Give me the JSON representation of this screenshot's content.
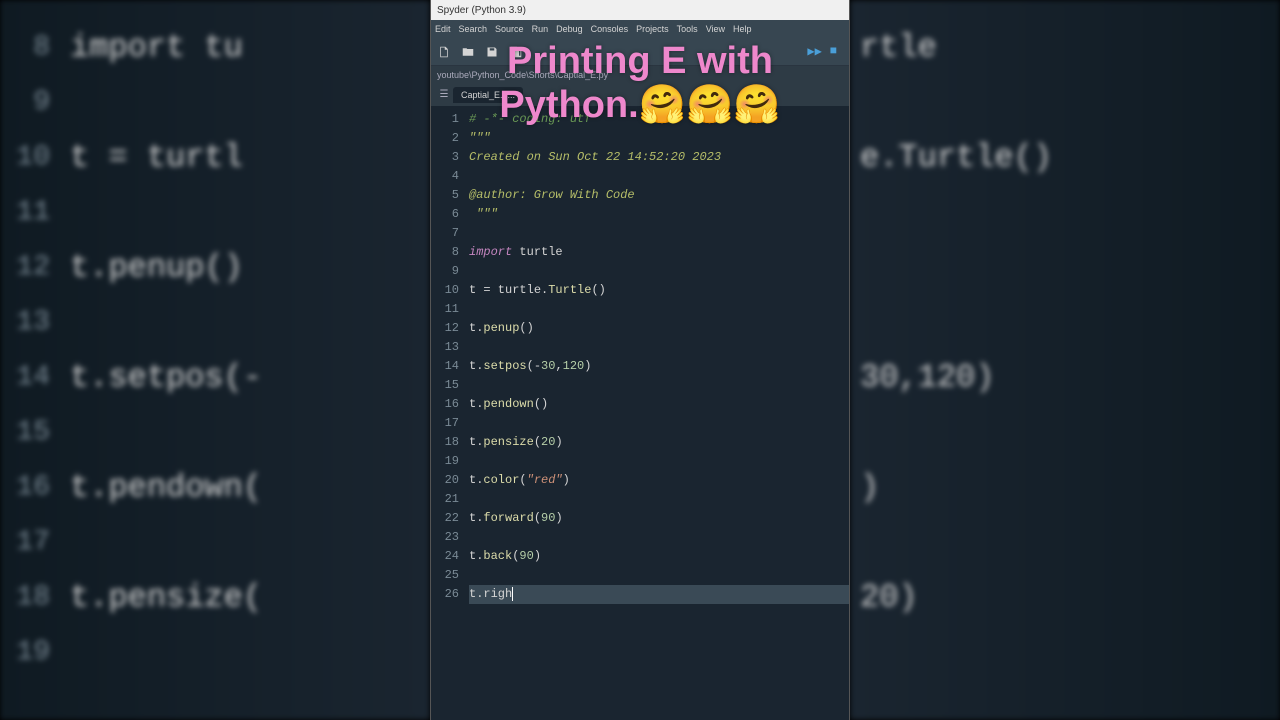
{
  "window": {
    "title": "Spyder (Python 3.9)"
  },
  "menu": [
    "Edit",
    "Search",
    "Source",
    "Run",
    "Debug",
    "Consoles",
    "Projects",
    "Tools",
    "View",
    "Help"
  ],
  "path": "youtube\\Python_Code\\Shorts\\Captial_E.py",
  "tab": {
    "name": "Captial_E.p..."
  },
  "overlay": {
    "line1": "Printing E with",
    "line2": "Python.🤗🤗🤗"
  },
  "code": {
    "lines": [
      {
        "n": 1,
        "t": [
          {
            "c": "c-comment",
            "v": "# -*- coding: utf"
          }
        ]
      },
      {
        "n": 2,
        "t": [
          {
            "c": "c-docstring",
            "v": "\"\"\""
          }
        ]
      },
      {
        "n": 3,
        "t": [
          {
            "c": "c-docstring",
            "v": "Created on Sun Oct 22 14:52:20 2023"
          }
        ]
      },
      {
        "n": 4,
        "t": []
      },
      {
        "n": 5,
        "t": [
          {
            "c": "c-docstring",
            "v": "@author: Grow With Code"
          }
        ]
      },
      {
        "n": 6,
        "t": [
          {
            "c": "c-docstring",
            "v": " \"\"\""
          }
        ]
      },
      {
        "n": 7,
        "t": []
      },
      {
        "n": 8,
        "t": [
          {
            "c": "c-keyword",
            "v": "import"
          },
          {
            "c": "c-ident",
            "v": " turtle"
          }
        ]
      },
      {
        "n": 9,
        "t": []
      },
      {
        "n": 10,
        "t": [
          {
            "c": "c-ident",
            "v": "t "
          },
          {
            "c": "c-op",
            "v": "="
          },
          {
            "c": "c-ident",
            "v": " turtle"
          },
          {
            "c": "c-op",
            "v": "."
          },
          {
            "c": "c-func",
            "v": "Turtle"
          },
          {
            "c": "c-op",
            "v": "()"
          }
        ]
      },
      {
        "n": 11,
        "t": []
      },
      {
        "n": 12,
        "t": [
          {
            "c": "c-ident",
            "v": "t"
          },
          {
            "c": "c-op",
            "v": "."
          },
          {
            "c": "c-func",
            "v": "penup"
          },
          {
            "c": "c-op",
            "v": "()"
          }
        ]
      },
      {
        "n": 13,
        "t": []
      },
      {
        "n": 14,
        "t": [
          {
            "c": "c-ident",
            "v": "t"
          },
          {
            "c": "c-op",
            "v": "."
          },
          {
            "c": "c-func",
            "v": "setpos"
          },
          {
            "c": "c-op",
            "v": "("
          },
          {
            "c": "c-op",
            "v": "-"
          },
          {
            "c": "c-number",
            "v": "30"
          },
          {
            "c": "c-op",
            "v": ","
          },
          {
            "c": "c-number",
            "v": "120"
          },
          {
            "c": "c-op",
            "v": ")"
          }
        ]
      },
      {
        "n": 15,
        "t": []
      },
      {
        "n": 16,
        "t": [
          {
            "c": "c-ident",
            "v": "t"
          },
          {
            "c": "c-op",
            "v": "."
          },
          {
            "c": "c-func",
            "v": "pendown"
          },
          {
            "c": "c-op",
            "v": "()"
          }
        ]
      },
      {
        "n": 17,
        "t": []
      },
      {
        "n": 18,
        "t": [
          {
            "c": "c-ident",
            "v": "t"
          },
          {
            "c": "c-op",
            "v": "."
          },
          {
            "c": "c-func",
            "v": "pensize"
          },
          {
            "c": "c-op",
            "v": "("
          },
          {
            "c": "c-number",
            "v": "20"
          },
          {
            "c": "c-op",
            "v": ")"
          }
        ]
      },
      {
        "n": 19,
        "t": []
      },
      {
        "n": 20,
        "t": [
          {
            "c": "c-ident",
            "v": "t"
          },
          {
            "c": "c-op",
            "v": "."
          },
          {
            "c": "c-func",
            "v": "color"
          },
          {
            "c": "c-op",
            "v": "("
          },
          {
            "c": "c-string",
            "v": "\"red\""
          },
          {
            "c": "c-op",
            "v": ")"
          }
        ]
      },
      {
        "n": 21,
        "t": []
      },
      {
        "n": 22,
        "t": [
          {
            "c": "c-ident",
            "v": "t"
          },
          {
            "c": "c-op",
            "v": "."
          },
          {
            "c": "c-func",
            "v": "forward"
          },
          {
            "c": "c-op",
            "v": "("
          },
          {
            "c": "c-number",
            "v": "90"
          },
          {
            "c": "c-op",
            "v": ")"
          }
        ]
      },
      {
        "n": 23,
        "t": []
      },
      {
        "n": 24,
        "t": [
          {
            "c": "c-ident",
            "v": "t"
          },
          {
            "c": "c-op",
            "v": "."
          },
          {
            "c": "c-func",
            "v": "back"
          },
          {
            "c": "c-op",
            "v": "("
          },
          {
            "c": "c-number",
            "v": "90"
          },
          {
            "c": "c-op",
            "v": ")"
          }
        ]
      },
      {
        "n": 25,
        "t": []
      },
      {
        "n": 26,
        "current": true,
        "t": [
          {
            "c": "c-ident",
            "v": "t"
          },
          {
            "c": "c-op",
            "v": "."
          },
          {
            "c": "c-ident",
            "v": "righ"
          }
        ],
        "cursor": true
      }
    ]
  },
  "bg_left": [
    {
      "n": 8,
      "v": "import tu"
    },
    {
      "n": 9,
      "v": ""
    },
    {
      "n": 10,
      "v": "t = turtl"
    },
    {
      "n": 11,
      "v": ""
    },
    {
      "n": 12,
      "v": "t.penup()"
    },
    {
      "n": 13,
      "v": ""
    },
    {
      "n": 14,
      "v": "t.setpos(-"
    },
    {
      "n": 15,
      "v": ""
    },
    {
      "n": 16,
      "v": "t.pendown("
    },
    {
      "n": 17,
      "v": ""
    },
    {
      "n": 18,
      "v": "t.pensize("
    },
    {
      "n": 19,
      "v": ""
    }
  ],
  "bg_right": [
    {
      "v": "rtle"
    },
    {
      "v": ""
    },
    {
      "v": "e.Turtle()"
    },
    {
      "v": ""
    },
    {
      "v": ""
    },
    {
      "v": ""
    },
    {
      "v": "30,120)"
    },
    {
      "v": ""
    },
    {
      "v": ")"
    },
    {
      "v": ""
    },
    {
      "v": "20)"
    },
    {
      "v": ""
    }
  ]
}
